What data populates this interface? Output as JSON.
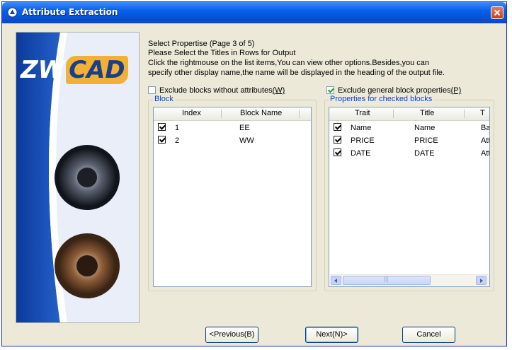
{
  "window": {
    "title": "Attribute Extraction"
  },
  "brand": {
    "logo_prefix": "ZW",
    "logo_suffix": "CAD"
  },
  "instructions": {
    "line1": "Select Propertise (Page 3 of 5)",
    "line2": "Please Select the Titles in Rows for Output",
    "line3": "Click the rightmouse on the list items,You can view other options.Besides,you can",
    "line4": "specify other display name,the name will be displayed in the heading of the output file."
  },
  "options": {
    "exclude_no_attr": {
      "label": "Exclude blocks without attributes",
      "hotkey": "(W)",
      "checked": false
    },
    "exclude_general": {
      "label": "Exclude general block properties",
      "hotkey": "(P)",
      "checked": true
    }
  },
  "block_group": {
    "label": "Block",
    "columns": [
      "Index",
      "Block Name"
    ],
    "rows": [
      {
        "index": "1",
        "name": "EE",
        "checked": true
      },
      {
        "index": "2",
        "name": "WW",
        "checked": true
      }
    ]
  },
  "props_group": {
    "label": "Properties for checked blocks",
    "columns": [
      "Trait",
      "Title",
      "T"
    ],
    "rows": [
      {
        "trait": "Name",
        "title": "Name",
        "extra": "Ba",
        "checked": true
      },
      {
        "trait": "PRICE",
        "title": "PRICE",
        "extra": "Att",
        "checked": true
      },
      {
        "trait": "DATE",
        "title": "DATE",
        "extra": "Att",
        "checked": true
      }
    ],
    "scroll_grip": "|||"
  },
  "buttons": {
    "previous": "<Previous(B)",
    "next": "Next(N)>",
    "cancel": "Cancel"
  },
  "colors": {
    "titlebar": "#0a5fe8",
    "group_label": "#0046d5",
    "dialog_bg": "#ece9d8"
  }
}
